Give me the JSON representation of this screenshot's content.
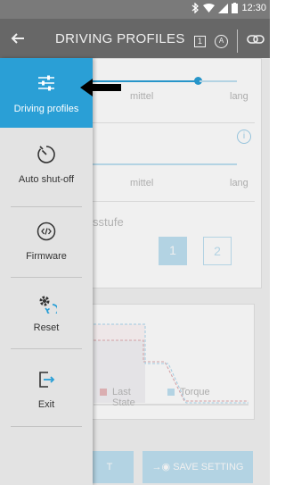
{
  "status_bar": {
    "time": "12:30"
  },
  "app_bar": {
    "title": "DRIVING PROFILES",
    "badge_1": "1",
    "badge_a": "A"
  },
  "drawer": {
    "items": [
      {
        "label": "Driving profiles",
        "icon": "sliders-icon",
        "active": true
      },
      {
        "label": "Auto shut-off",
        "icon": "timer-icon",
        "active": false
      },
      {
        "label": "Firmware",
        "icon": "code-icon",
        "active": false
      },
      {
        "label": "Reset",
        "icon": "gear-reset-icon",
        "active": false
      },
      {
        "label": "Exit",
        "icon": "exit-icon",
        "active": false
      }
    ]
  },
  "background": {
    "row1": {
      "mid": "mittel",
      "long": "lang"
    },
    "row2": {
      "mid": "mittel",
      "long": "lang"
    },
    "level": {
      "label": "sstufe",
      "btn1": "1",
      "btn2": "2"
    },
    "legend": {
      "last": "Last",
      "state": "State",
      "torque": "Torque"
    },
    "bottom": {
      "left": "T",
      "save": "SAVE SETTING"
    }
  },
  "colors": {
    "accent": "#2a9fd6",
    "drawer_bg": "#e3e3e3",
    "appbar": "#6e6e6e",
    "status": "#7a7a7a"
  }
}
